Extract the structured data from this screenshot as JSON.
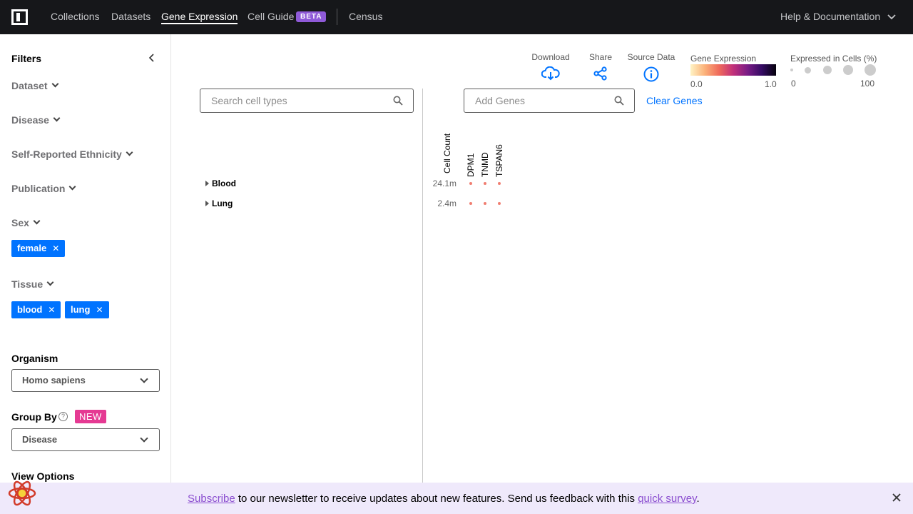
{
  "nav": {
    "links": [
      "Collections",
      "Datasets",
      "Gene Expression",
      "Cell Guide",
      "Census"
    ],
    "beta": "BETA",
    "help": "Help & Documentation"
  },
  "sidebar": {
    "title": "Filters",
    "filters": [
      "Dataset",
      "Disease",
      "Self-Reported Ethnicity",
      "Publication",
      "Sex",
      "Tissue"
    ],
    "sex_tags": [
      "female"
    ],
    "tissue_tags": [
      "blood",
      "lung"
    ],
    "organism_label": "Organism",
    "organism_value": "Homo sapiens",
    "group_by_label": "Group By",
    "group_by_badge": "NEW",
    "group_by_value": "Disease",
    "view_options_label": "View Options"
  },
  "toolbar": {
    "download": "Download",
    "share": "Share",
    "source_data": "Source Data",
    "gene_expression_label": "Gene Expression",
    "gene_expression_min": "0.0",
    "gene_expression_max": "1.0",
    "expressed_label": "Expressed in Cells (%)",
    "expressed_min": "0",
    "expressed_max": "100"
  },
  "search": {
    "cell_types_placeholder": "Search cell types",
    "genes_placeholder": "Add Genes",
    "clear_genes": "Clear Genes"
  },
  "grid": {
    "cell_count_header": "Cell Count",
    "genes": [
      "DPM1",
      "TNMD",
      "TSPAN6"
    ],
    "rows": [
      {
        "tissue": "Blood",
        "cell_count": "24.1m"
      },
      {
        "tissue": "Lung",
        "cell_count": "2.4m"
      }
    ]
  },
  "banner": {
    "subscribe": "Subscribe",
    "text": " to our newsletter to receive updates about new features. Send us feedback with this ",
    "survey": "quick survey",
    "end": "."
  },
  "colors": {
    "accent": "#0073ff",
    "nav_bg": "#16171a",
    "dot": "#f07e71",
    "banner_bg": "#efe9fb"
  }
}
